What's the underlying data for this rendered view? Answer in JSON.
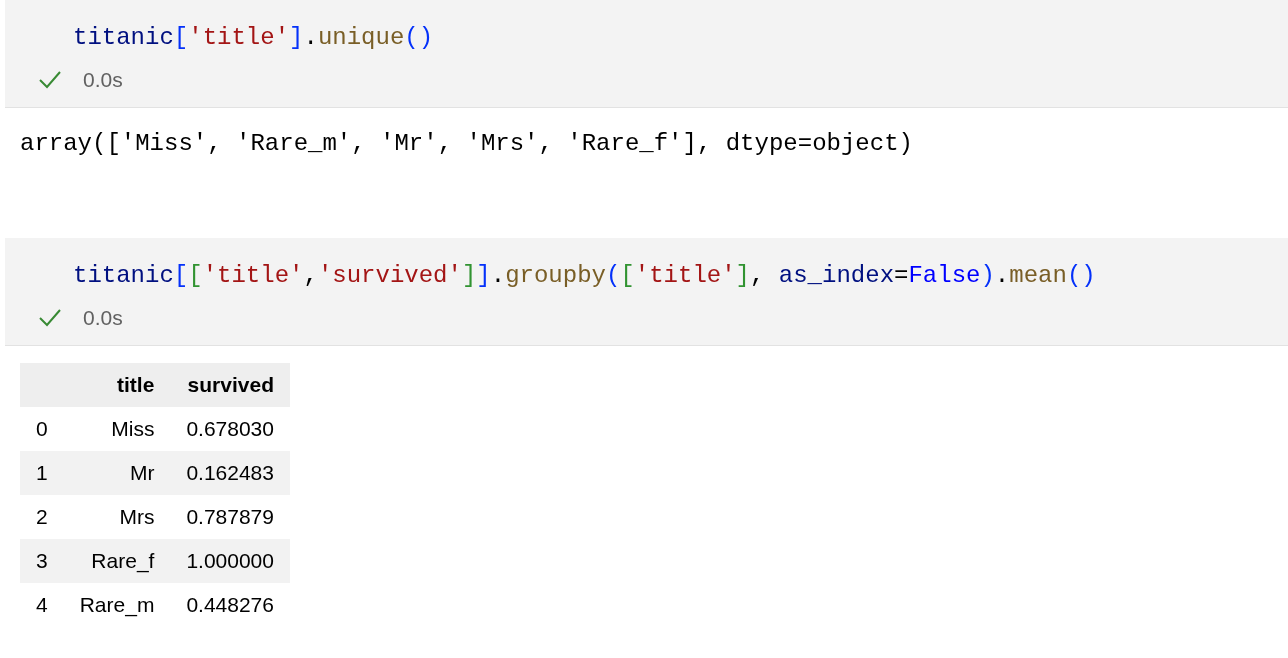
{
  "cells": [
    {
      "code": [
        {
          "text": "titanic",
          "color": "#001080"
        },
        {
          "text": "[",
          "color": "#0431fa"
        },
        {
          "text": "'title'",
          "color": "#a31515"
        },
        {
          "text": "]",
          "color": "#0431fa"
        },
        {
          "text": ".",
          "color": "#000000"
        },
        {
          "text": "unique",
          "color": "#795e26"
        },
        {
          "text": "()",
          "color": "#0431fa"
        }
      ],
      "status": {
        "succeeded": true,
        "time": "0.0s"
      },
      "output": {
        "kind": "text",
        "text": "array(['Miss', 'Rare_m', 'Mr', 'Mrs', 'Rare_f'], dtype=object)"
      }
    },
    {
      "code": [
        {
          "text": "titanic",
          "color": "#001080"
        },
        {
          "text": "[",
          "color": "#0431fa"
        },
        {
          "text": "[",
          "color": "#319331"
        },
        {
          "text": "'title'",
          "color": "#a31515"
        },
        {
          "text": ",",
          "color": "#000000"
        },
        {
          "text": "'survived'",
          "color": "#a31515"
        },
        {
          "text": "]",
          "color": "#319331"
        },
        {
          "text": "]",
          "color": "#0431fa"
        },
        {
          "text": ".",
          "color": "#000000"
        },
        {
          "text": "groupby",
          "color": "#795e26"
        },
        {
          "text": "(",
          "color": "#0431fa"
        },
        {
          "text": "[",
          "color": "#319331"
        },
        {
          "text": "'title'",
          "color": "#a31515"
        },
        {
          "text": "]",
          "color": "#319331"
        },
        {
          "text": ", ",
          "color": "#000000"
        },
        {
          "text": "as_index",
          "color": "#001080"
        },
        {
          "text": "=",
          "color": "#000000"
        },
        {
          "text": "False",
          "color": "#0000ff"
        },
        {
          "text": ")",
          "color": "#0431fa"
        },
        {
          "text": ".",
          "color": "#000000"
        },
        {
          "text": "mean",
          "color": "#795e26"
        },
        {
          "text": "()",
          "color": "#0431fa"
        }
      ],
      "status": {
        "succeeded": true,
        "time": "0.0s"
      },
      "output": {
        "kind": "table",
        "table": {
          "columns": [
            "",
            "title",
            "survived"
          ],
          "rows": [
            [
              "0",
              "Miss",
              "0.678030"
            ],
            [
              "1",
              "Mr",
              "0.162483"
            ],
            [
              "2",
              "Mrs",
              "0.787879"
            ],
            [
              "3",
              "Rare_f",
              "1.000000"
            ],
            [
              "4",
              "Rare_m",
              "0.448276"
            ]
          ]
        }
      }
    }
  ]
}
